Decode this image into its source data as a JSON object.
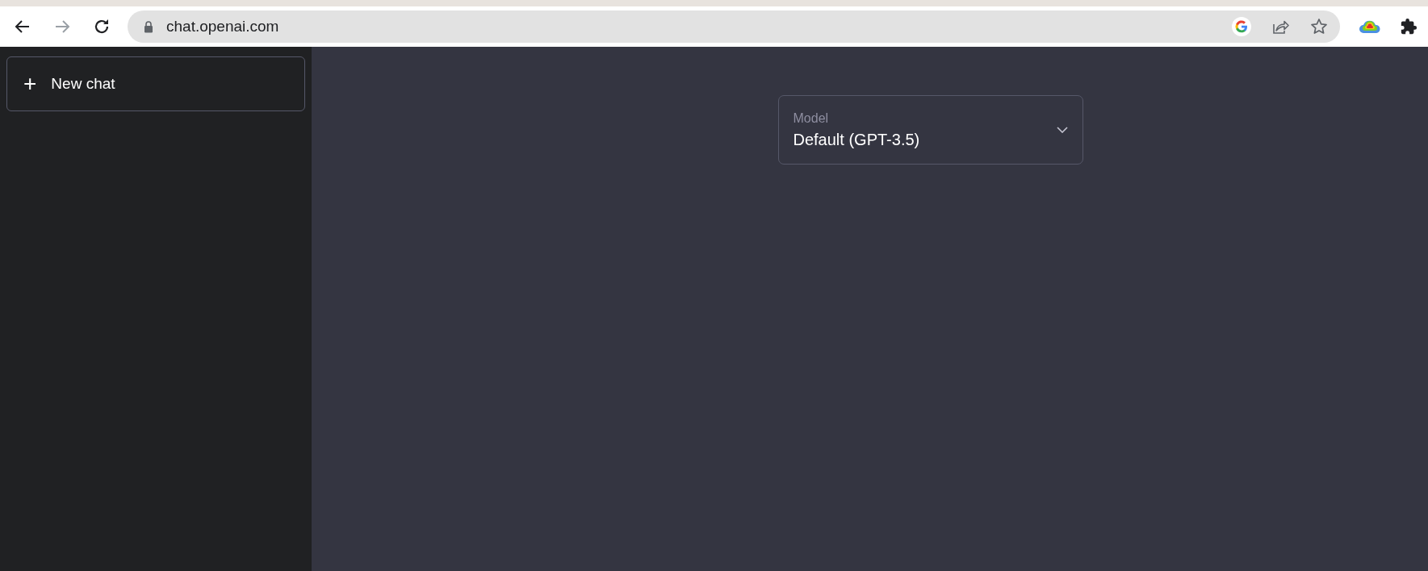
{
  "browser": {
    "nav_buttons": [
      {
        "kind": "back",
        "disabled": false
      },
      {
        "kind": "forward",
        "disabled": true
      },
      {
        "kind": "reload",
        "disabled": false
      }
    ],
    "address": "chat.openai.com"
  },
  "sidebar": {
    "new_chat": {
      "label": "New chat",
      "icon": "+"
    }
  },
  "model_select": {
    "label": "Model",
    "value": "Default (GPT-3.5)"
  }
}
